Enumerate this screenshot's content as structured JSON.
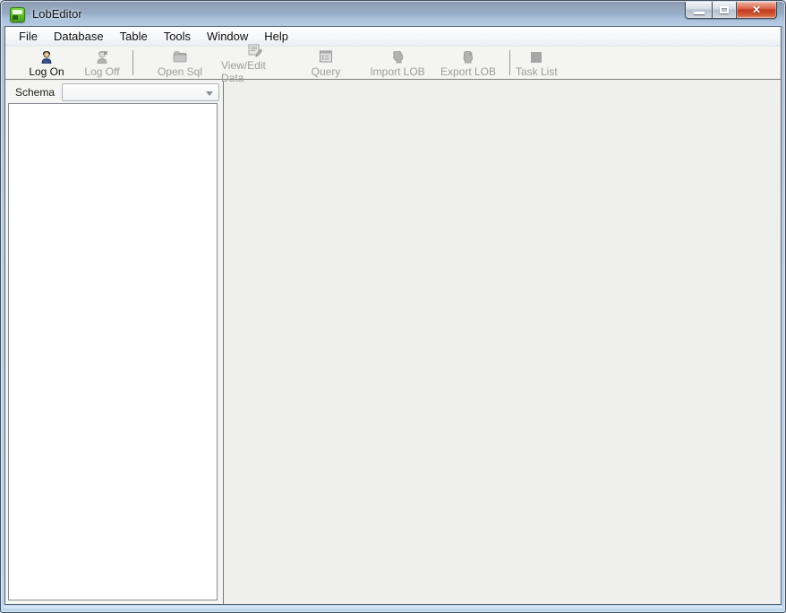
{
  "window": {
    "title": "LobEditor",
    "controls": {
      "minimize": "minimize",
      "maximize": "maximize",
      "close": "close"
    }
  },
  "menu": {
    "items": [
      {
        "label": "File"
      },
      {
        "label": "Database"
      },
      {
        "label": "Table"
      },
      {
        "label": "Tools"
      },
      {
        "label": "Window"
      },
      {
        "label": "Help"
      }
    ]
  },
  "toolbar": {
    "buttons": [
      {
        "label": "Log On",
        "icon": "user-logon-icon",
        "enabled": true
      },
      {
        "label": "Log Off",
        "icon": "user-logoff-icon",
        "enabled": false
      },
      {
        "label": "Open Sql",
        "icon": "folder-icon",
        "enabled": false
      },
      {
        "label": "View/Edit Data",
        "icon": "edit-data-icon",
        "enabled": false
      },
      {
        "label": "Query",
        "icon": "query-window-icon",
        "enabled": false
      },
      {
        "label": "Import LOB",
        "icon": "import-lob-icon",
        "enabled": false
      },
      {
        "label": "Export LOB",
        "icon": "export-lob-icon",
        "enabled": false
      },
      {
        "label": "Task List",
        "icon": "task-list-icon",
        "enabled": false
      }
    ]
  },
  "sidebar": {
    "schema_label": "Schema",
    "schema_value": "",
    "schema_placeholder": ""
  },
  "colors": {
    "titlebar_top": "#5f7292",
    "titlebar_bottom": "#b6cbe4",
    "close_button_red": "#c23a20",
    "toolbar_bg": "#f4f4f2",
    "disabled_text": "#9d9d9d",
    "enabled_text": "#101010",
    "mdi_bg": "#efefed",
    "app_icon_green": "#46a81e"
  }
}
